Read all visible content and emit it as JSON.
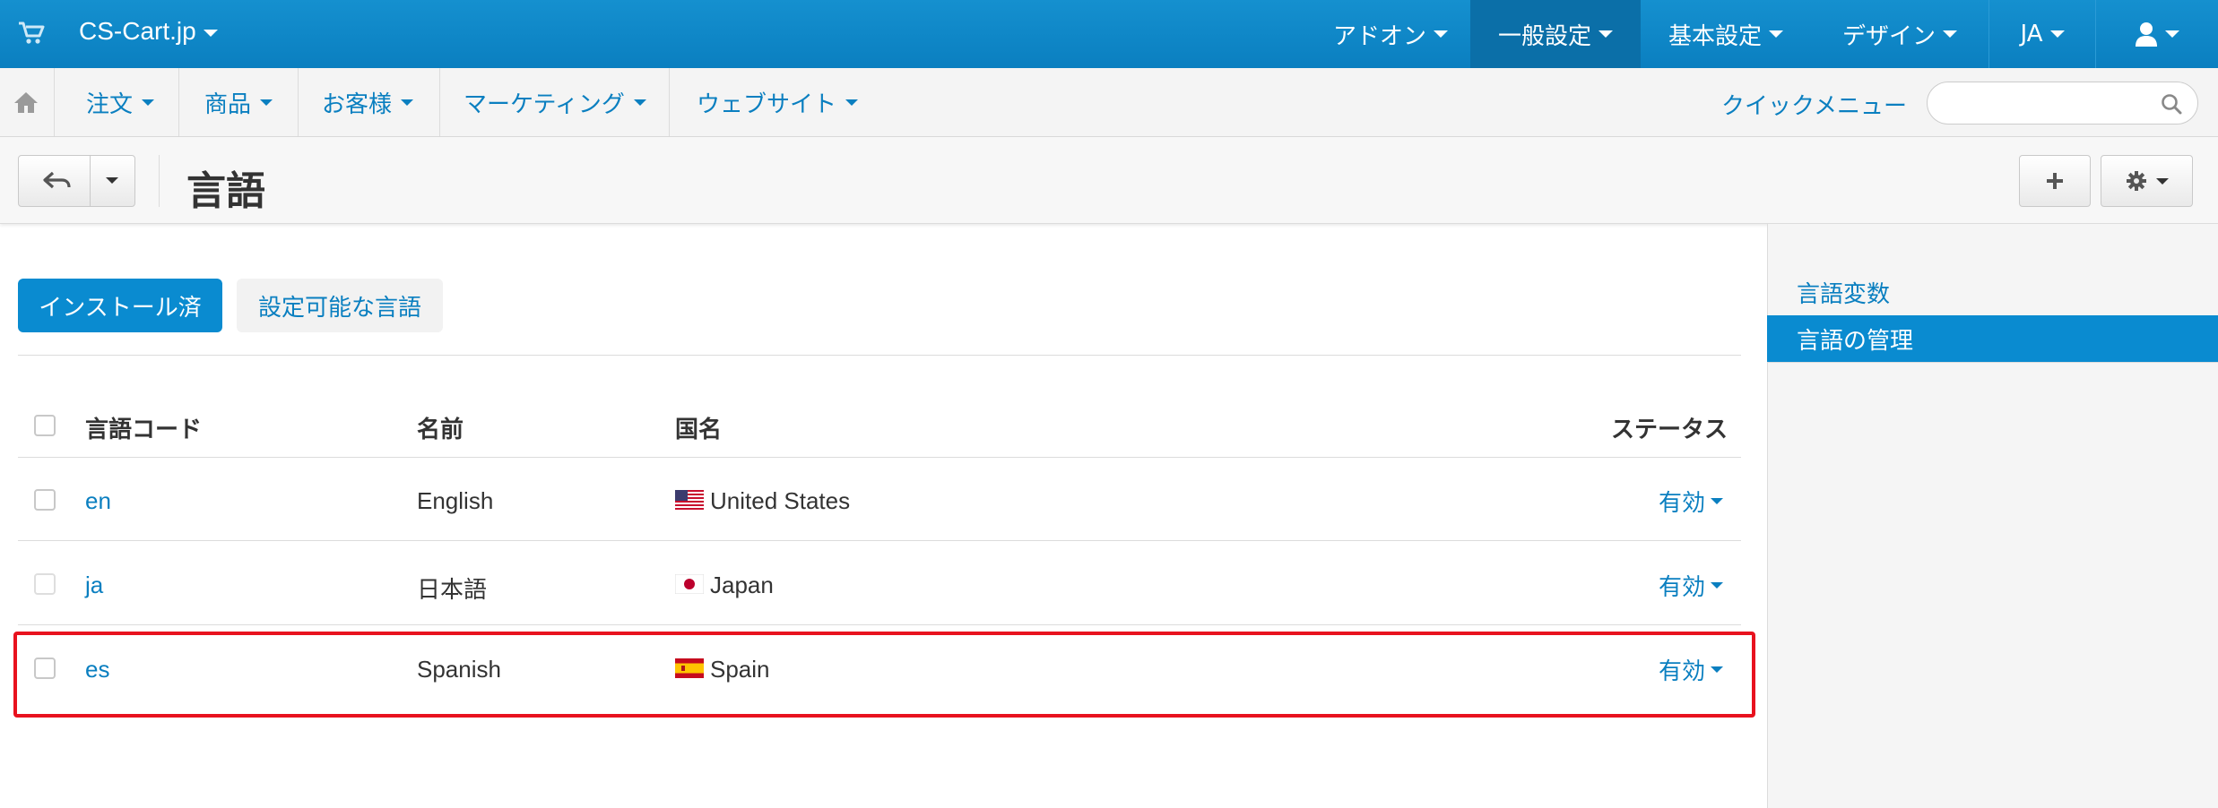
{
  "app": {
    "brand": "CS-Cart.jp"
  },
  "top_menu": [
    {
      "label": "アドオン"
    },
    {
      "label": "一般設定"
    },
    {
      "label": "基本設定"
    },
    {
      "label": "デザイン"
    },
    {
      "label": "JA"
    }
  ],
  "main_nav": [
    {
      "label": "注文"
    },
    {
      "label": "商品"
    },
    {
      "label": "お客様"
    },
    {
      "label": "マーケティング"
    },
    {
      "label": "ウェブサイト"
    }
  ],
  "quick_menu": {
    "label": "クイックメニュー"
  },
  "search": {
    "placeholder": ""
  },
  "page": {
    "title": "言語"
  },
  "tabs": [
    {
      "label": "インストール済"
    },
    {
      "label": "設定可能な言語"
    }
  ],
  "table": {
    "headers": {
      "code": "言語コード",
      "name": "名前",
      "country": "国名",
      "status": "ステータス"
    },
    "rows": [
      {
        "code": "en",
        "name": "English",
        "country": "United States",
        "status": "有効",
        "flag": "us-flag-icon"
      },
      {
        "code": "ja",
        "name": "日本語",
        "country": "Japan",
        "status": "有効",
        "flag": "jp-flag-icon"
      },
      {
        "code": "es",
        "name": "Spanish",
        "country": "Spain",
        "status": "有効",
        "flag": "es-flag-icon"
      }
    ]
  },
  "sidebar": {
    "items": [
      {
        "label": "言語変数"
      },
      {
        "label": "言語の管理"
      }
    ]
  },
  "colors": {
    "primary": "#0a7fc0",
    "active_tab": "#0a8bd0",
    "highlight": "#e8121e"
  }
}
